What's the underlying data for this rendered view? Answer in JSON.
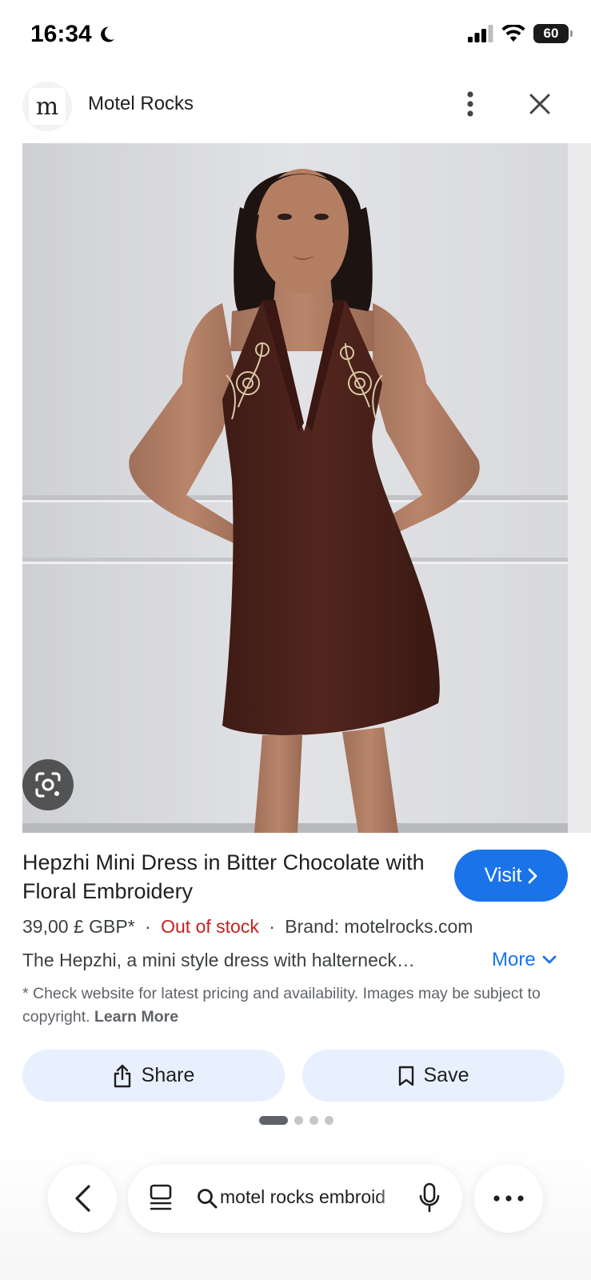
{
  "status_bar": {
    "time": "16:34",
    "battery": "60",
    "icons": [
      "moon-icon",
      "signal-icon",
      "wifi-icon",
      "battery-icon"
    ]
  },
  "header": {
    "logo_letter": "m",
    "site_name": "Motel Rocks",
    "icons": [
      "more-vert-icon",
      "close-icon"
    ]
  },
  "product": {
    "title": "Hepzhi Mini Dress in Bitter Chocolate with Floral Embroidery",
    "visit_label": "Visit",
    "price": "39,00 £ GBP*",
    "separator": "·",
    "stock_status": "Out of stock",
    "brand": "Brand: motelrocks.com",
    "description": "The Hepzhi, a mini style dress with halterneck…",
    "more_label": "More",
    "disclaimer": "* Check website for latest pricing and availability. Images may be subject to copyright.",
    "learn_more": "Learn More"
  },
  "actions": {
    "share_label": "Share",
    "save_label": "Save"
  },
  "pager": {
    "total": 4,
    "active": 1
  },
  "bottom_bar": {
    "search_query": "motel rocks embroid",
    "icons": [
      "back-icon",
      "tabs-icon",
      "search-icon",
      "mic-icon",
      "more-horiz-icon"
    ]
  },
  "colors": {
    "accent": "#1a73e8",
    "out_of_stock": "#c5221f",
    "button_bg": "#e8f0fe",
    "dress": "#4a221b"
  }
}
